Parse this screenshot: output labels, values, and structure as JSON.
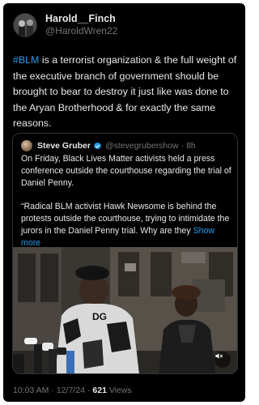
{
  "post": {
    "author": {
      "display_name": "Harold__Finch",
      "handle": "@HaroldWren22"
    },
    "text": {
      "hashtag": "#BLM",
      "body": " is a terrorist organization & the full weight of the executive branch of government should be brought to bear to destroy it just like was done to the Aryan Brotherhood & for exactly the same reasons."
    },
    "meta": {
      "time": "10:03 AM",
      "separator": "·",
      "date": "12/7/24",
      "views_count": "621",
      "views_label": "Views"
    }
  },
  "quote": {
    "author": {
      "display_name": "Steve Gruber",
      "handle": "@stevegrubershow",
      "separator": "·",
      "time": "8h"
    },
    "paragraph_1": "On Friday, Black Lives Matter activists held a press conference outside the courthouse regarding the trial of Daniel Penny.",
    "paragraph_2": "“Radical BLM activist Hawk Newsome is behind the protests outside the courthouse, trying to intimidate the jurors in the Daniel Penny trial. Why are they",
    "show_more": "Show more",
    "media_jersey_text": "DG"
  },
  "colors": {
    "background": "#000000",
    "text_primary": "#e7e9ea",
    "text_secondary": "#71767b",
    "accent": "#1d9bf0",
    "border": "#2f3336"
  },
  "icons": {
    "verified": "verified-badge-icon",
    "volume": "speaker-icon"
  }
}
